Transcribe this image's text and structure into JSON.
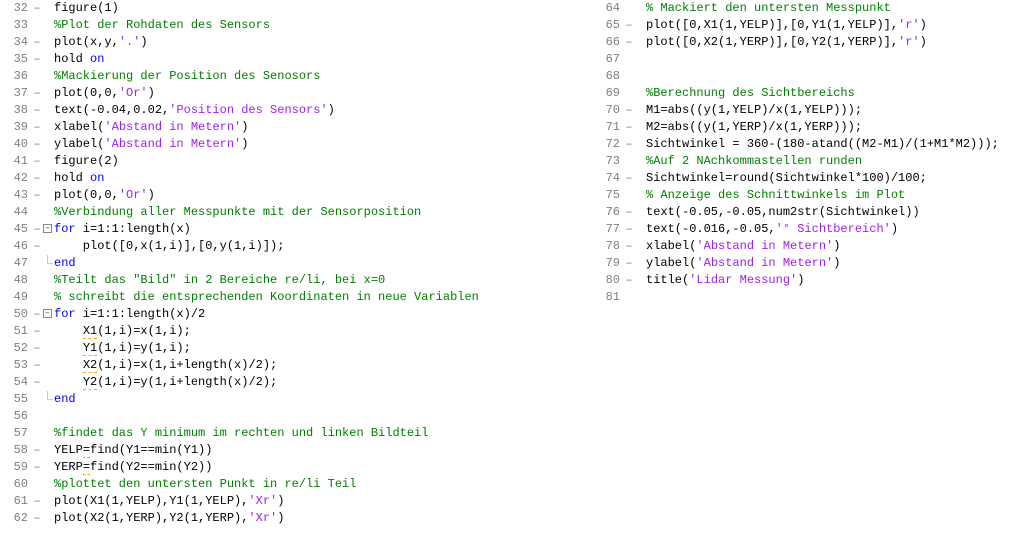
{
  "left": [
    {
      "n": 32,
      "d": "–",
      "f": "",
      "code": [
        {
          "t": "figure(1)",
          "c": ""
        }
      ]
    },
    {
      "n": 33,
      "d": "",
      "f": "",
      "code": [
        {
          "t": "%Plot der Rohdaten des Sensors",
          "c": "com"
        }
      ]
    },
    {
      "n": 34,
      "d": "–",
      "f": "",
      "code": [
        {
          "t": "plot(x,y,",
          "c": ""
        },
        {
          "t": "'.'",
          "c": "str"
        },
        {
          "t": ")",
          "c": ""
        }
      ]
    },
    {
      "n": 35,
      "d": "–",
      "f": "",
      "code": [
        {
          "t": "hold ",
          "c": ""
        },
        {
          "t": "on",
          "c": "kw"
        }
      ]
    },
    {
      "n": 36,
      "d": "",
      "f": "",
      "code": [
        {
          "t": "%Mackierung der Position des Senosors",
          "c": "com"
        }
      ]
    },
    {
      "n": 37,
      "d": "–",
      "f": "",
      "code": [
        {
          "t": "plot(0,0,",
          "c": ""
        },
        {
          "t": "'Or'",
          "c": "str"
        },
        {
          "t": ")",
          "c": ""
        }
      ]
    },
    {
      "n": 38,
      "d": "–",
      "f": "",
      "code": [
        {
          "t": "text(-0.04,0.02,",
          "c": ""
        },
        {
          "t": "'Position des Sensors'",
          "c": "str"
        },
        {
          "t": ")",
          "c": ""
        }
      ]
    },
    {
      "n": 39,
      "d": "–",
      "f": "",
      "code": [
        {
          "t": "xlabel(",
          "c": ""
        },
        {
          "t": "'Abstand in Metern'",
          "c": "str"
        },
        {
          "t": ")",
          "c": ""
        }
      ]
    },
    {
      "n": 40,
      "d": "–",
      "f": "",
      "code": [
        {
          "t": "ylabel(",
          "c": ""
        },
        {
          "t": "'Abstand in Metern'",
          "c": "str"
        },
        {
          "t": ")",
          "c": ""
        }
      ]
    },
    {
      "n": 41,
      "d": "–",
      "f": "",
      "code": [
        {
          "t": "figure(2)",
          "c": ""
        }
      ]
    },
    {
      "n": 42,
      "d": "–",
      "f": "",
      "code": [
        {
          "t": "hold ",
          "c": ""
        },
        {
          "t": "on",
          "c": "kw"
        }
      ]
    },
    {
      "n": 43,
      "d": "–",
      "f": "",
      "code": [
        {
          "t": "plot(0,0,",
          "c": ""
        },
        {
          "t": "'Or'",
          "c": "str"
        },
        {
          "t": ")",
          "c": ""
        }
      ]
    },
    {
      "n": 44,
      "d": "",
      "f": "",
      "code": [
        {
          "t": "%Verbindung aller Messpunkte mit der Sensorposition",
          "c": "com"
        }
      ]
    },
    {
      "n": 45,
      "d": "–",
      "f": "open",
      "code": [
        {
          "t": "for",
          "c": "kw"
        },
        {
          "t": " i=1:1:length(x)",
          "c": ""
        }
      ]
    },
    {
      "n": 46,
      "d": "–",
      "f": "line",
      "code": [
        {
          "t": "    plot([0,x(1,i)],[0,y(1,i)]);",
          "c": ""
        }
      ]
    },
    {
      "n": 47,
      "d": "",
      "f": "end",
      "code": [
        {
          "t": "end",
          "c": "kw"
        }
      ]
    },
    {
      "n": 48,
      "d": "",
      "f": "",
      "code": [
        {
          "t": "%Teilt das \"Bild\" in 2 Bereiche re/li, bei x=0",
          "c": "com"
        }
      ]
    },
    {
      "n": 49,
      "d": "",
      "f": "",
      "code": [
        {
          "t": "% schreibt die entsprechenden Koordinaten in neue Variablen",
          "c": "com"
        }
      ]
    },
    {
      "n": 50,
      "d": "–",
      "f": "open",
      "code": [
        {
          "t": "for",
          "c": "kw"
        },
        {
          "t": " i=1:1:length(x)/2",
          "c": ""
        }
      ]
    },
    {
      "n": 51,
      "d": "–",
      "f": "line",
      "code": [
        {
          "t": "    ",
          "c": ""
        },
        {
          "t": "X1",
          "c": "warn"
        },
        {
          "t": "(1,i)=x(1,i);",
          "c": ""
        }
      ]
    },
    {
      "n": 52,
      "d": "–",
      "f": "line",
      "code": [
        {
          "t": "    ",
          "c": ""
        },
        {
          "t": "Y1",
          "c": "warn"
        },
        {
          "t": "(1,i)=y(1,i);",
          "c": ""
        }
      ]
    },
    {
      "n": 53,
      "d": "–",
      "f": "line",
      "code": [
        {
          "t": "    ",
          "c": ""
        },
        {
          "t": "X2",
          "c": "warn"
        },
        {
          "t": "(1,i)=x(1,i+length(x)/2);",
          "c": ""
        }
      ]
    },
    {
      "n": 54,
      "d": "–",
      "f": "line",
      "code": [
        {
          "t": "    ",
          "c": ""
        },
        {
          "t": "Y2",
          "c": "warn"
        },
        {
          "t": "(1,i)=y(1,i+length(x)/2);",
          "c": ""
        }
      ]
    },
    {
      "n": 55,
      "d": "",
      "f": "end",
      "code": [
        {
          "t": "end",
          "c": "kw"
        }
      ]
    },
    {
      "n": 56,
      "d": "",
      "f": "",
      "code": [
        {
          "t": "",
          "c": ""
        }
      ]
    },
    {
      "n": 57,
      "d": "",
      "f": "",
      "code": [
        {
          "t": "%findet das Y minimum im rechten und linken Bildteil",
          "c": "com"
        }
      ]
    },
    {
      "n": 58,
      "d": "–",
      "f": "",
      "code": [
        {
          "t": "YELP",
          "c": ""
        },
        {
          "t": "=",
          "c": "warn"
        },
        {
          "t": "find(Y1==min(Y1))",
          "c": ""
        }
      ]
    },
    {
      "n": 59,
      "d": "–",
      "f": "",
      "code": [
        {
          "t": "YERP",
          "c": ""
        },
        {
          "t": "=",
          "c": "warn"
        },
        {
          "t": "find(Y2==min(Y2))",
          "c": ""
        }
      ]
    },
    {
      "n": 60,
      "d": "",
      "f": "",
      "code": [
        {
          "t": "%plottet den untersten Punkt in re/li Teil",
          "c": "com"
        }
      ]
    },
    {
      "n": 61,
      "d": "–",
      "f": "",
      "code": [
        {
          "t": "plot(X1(1,YELP),Y1(1,YELP),",
          "c": ""
        },
        {
          "t": "'Xr'",
          "c": "str"
        },
        {
          "t": ")",
          "c": ""
        }
      ]
    },
    {
      "n": 62,
      "d": "–",
      "f": "",
      "code": [
        {
          "t": "plot(X2(1,YERP),Y2(1,YERP),",
          "c": ""
        },
        {
          "t": "'Xr'",
          "c": "str"
        },
        {
          "t": ")",
          "c": ""
        }
      ]
    }
  ],
  "right": [
    {
      "n": 64,
      "d": "",
      "f": "",
      "code": [
        {
          "t": "% Mackiert den untersten Messpunkt",
          "c": "com"
        }
      ]
    },
    {
      "n": 65,
      "d": "–",
      "f": "",
      "code": [
        {
          "t": "plot([0,X1(1,YELP)],[0,Y1(1,YELP)],",
          "c": ""
        },
        {
          "t": "'r'",
          "c": "str"
        },
        {
          "t": ")",
          "c": ""
        }
      ]
    },
    {
      "n": 66,
      "d": "–",
      "f": "",
      "code": [
        {
          "t": "plot([0,X2(1,YERP)],[0,Y2(1,YERP)],",
          "c": ""
        },
        {
          "t": "'r'",
          "c": "str"
        },
        {
          "t": ")",
          "c": ""
        }
      ]
    },
    {
      "n": 67,
      "d": "",
      "f": "",
      "code": [
        {
          "t": "",
          "c": ""
        }
      ]
    },
    {
      "n": 68,
      "d": "",
      "f": "",
      "code": [
        {
          "t": "",
          "c": ""
        }
      ]
    },
    {
      "n": 69,
      "d": "",
      "f": "",
      "code": [
        {
          "t": "%Berechnung des Sichtbereichs",
          "c": "com"
        }
      ]
    },
    {
      "n": 70,
      "d": "–",
      "f": "",
      "code": [
        {
          "t": "M1=abs((y(1,YELP)/x(1,YELP)));",
          "c": ""
        }
      ]
    },
    {
      "n": 71,
      "d": "–",
      "f": "",
      "code": [
        {
          "t": "M2=abs((y(1,YERP)/x(1,YERP)));",
          "c": ""
        }
      ]
    },
    {
      "n": 72,
      "d": "–",
      "f": "",
      "code": [
        {
          "t": "Sichtwinkel = 360-(180-atand((M2-M1)/(1+M1*M2)));",
          "c": ""
        }
      ]
    },
    {
      "n": 73,
      "d": "",
      "f": "",
      "code": [
        {
          "t": "%Auf 2 NAchkommastellen runden",
          "c": "com"
        }
      ]
    },
    {
      "n": 74,
      "d": "–",
      "f": "",
      "code": [
        {
          "t": "Sichtwinkel=round(Sichtwinkel*100)/100;",
          "c": ""
        }
      ]
    },
    {
      "n": 75,
      "d": "",
      "f": "",
      "code": [
        {
          "t": "% Anzeige des Schnittwinkels im Plot",
          "c": "com"
        }
      ]
    },
    {
      "n": 76,
      "d": "–",
      "f": "",
      "code": [
        {
          "t": "text(-0.05,-0.05,num2str(Sichtwinkel))",
          "c": ""
        }
      ]
    },
    {
      "n": 77,
      "d": "–",
      "f": "",
      "code": [
        {
          "t": "text(-0.016,-0.05,",
          "c": ""
        },
        {
          "t": "'° Sichtbereich'",
          "c": "str"
        },
        {
          "t": ")",
          "c": ""
        }
      ]
    },
    {
      "n": 78,
      "d": "–",
      "f": "",
      "code": [
        {
          "t": "xlabel(",
          "c": ""
        },
        {
          "t": "'Abstand in Metern'",
          "c": "str"
        },
        {
          "t": ")",
          "c": ""
        }
      ]
    },
    {
      "n": 79,
      "d": "–",
      "f": "",
      "code": [
        {
          "t": "ylabel(",
          "c": ""
        },
        {
          "t": "'Abstand in Metern'",
          "c": "str"
        },
        {
          "t": ")",
          "c": ""
        }
      ]
    },
    {
      "n": 80,
      "d": "–",
      "f": "",
      "code": [
        {
          "t": "title(",
          "c": ""
        },
        {
          "t": "'Lidar Messung'",
          "c": "str"
        },
        {
          "t": ")",
          "c": ""
        }
      ]
    },
    {
      "n": 81,
      "d": "",
      "f": "",
      "code": [
        {
          "t": "",
          "c": ""
        }
      ]
    }
  ],
  "foldSymbol": "–"
}
